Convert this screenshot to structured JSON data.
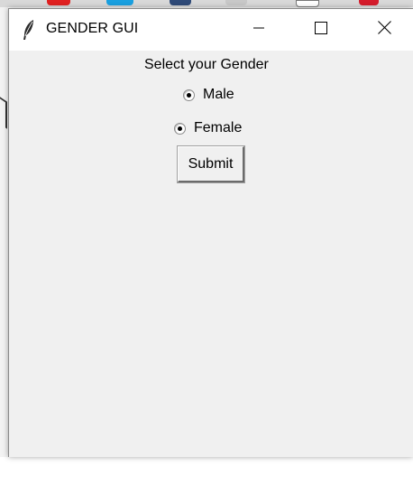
{
  "window": {
    "title": "GENDER GUI",
    "controls": {
      "minimize_icon": "minimize-icon",
      "maximize_icon": "maximize-icon",
      "close_icon": "close-icon"
    }
  },
  "form": {
    "prompt": "Select your Gender",
    "options": [
      {
        "label": "Male",
        "selected": true
      },
      {
        "label": "Female",
        "selected": true
      }
    ],
    "submit_label": "Submit"
  },
  "colors": {
    "window_bg": "#f0f0f0",
    "titlebar_bg": "#ffffff"
  }
}
